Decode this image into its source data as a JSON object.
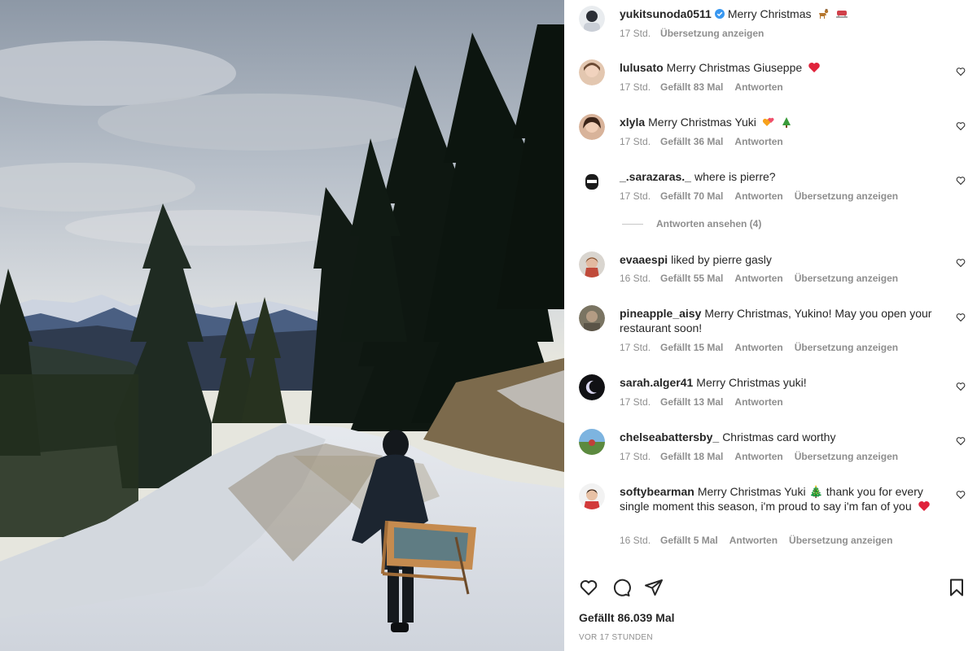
{
  "post": {
    "author": "yukitsunoda0511",
    "verified": true,
    "caption": "Merry Christmas",
    "caption_emojis": [
      "reindeer",
      "sled"
    ],
    "time": "17 Std.",
    "translate": "Übersetzung anzeigen"
  },
  "comments": [
    {
      "user": "lulusato",
      "text": "Merry Christmas Giuseppe",
      "emojis": [
        "red-heart"
      ],
      "time": "17 Std.",
      "likes": "Gefällt 83 Mal",
      "reply": "Antworten",
      "translate": ""
    },
    {
      "user": "xlyla",
      "text": "Merry Christmas Yuki",
      "emojis": [
        "two-hearts",
        "christmas-tree"
      ],
      "time": "17 Std.",
      "likes": "Gefällt 36 Mal",
      "reply": "Antworten",
      "translate": ""
    },
    {
      "user": "_.sarazaras._",
      "text": "where is pierre?",
      "emojis": [],
      "time": "17 Std.",
      "likes": "Gefällt 70 Mal",
      "reply": "Antworten",
      "translate": "Übersetzung anzeigen"
    },
    {
      "user": "evaaespi",
      "text": "liked by pierre gasly",
      "emojis": [],
      "time": "16 Std.",
      "likes": "Gefällt 55 Mal",
      "reply": "Antworten",
      "translate": "Übersetzung anzeigen"
    },
    {
      "user": "pineapple_aisy",
      "text": "Merry Christmas, Yukino! May you open your restaurant soon!",
      "emojis": [],
      "time": "17 Std.",
      "likes": "Gefällt 15 Mal",
      "reply": "Antworten",
      "translate": "Übersetzung anzeigen"
    },
    {
      "user": "sarah.alger41",
      "text": "Merry Christmas yuki!",
      "emojis": [],
      "time": "17 Std.",
      "likes": "Gefällt 13 Mal",
      "reply": "Antworten",
      "translate": ""
    },
    {
      "user": "chelseabattersby_",
      "text": "Christmas card worthy",
      "emojis": [],
      "time": "17 Std.",
      "likes": "Gefällt 18 Mal",
      "reply": "Antworten",
      "translate": "Übersetzung anzeigen"
    },
    {
      "user": "softybearman",
      "text": "Merry Christmas Yuki 🎄 thank you for every single moment this season, i'm proud to say i'm fan of you",
      "emojis": [
        "red-heart"
      ],
      "time": "16 Std.",
      "likes": "Gefällt 5 Mal",
      "reply": "Antworten",
      "translate": "Übersetzung anzeigen"
    }
  ],
  "view_replies": "Antworten ansehen (4)",
  "actions": {
    "like_icon": "heart-outline-icon",
    "comment_icon": "comment-bubble-icon",
    "share_icon": "paper-plane-icon",
    "save_icon": "bookmark-icon"
  },
  "likes_total": "Gefällt 86.039 Mal",
  "post_time": "VOR 17 STUNDEN",
  "colors": {
    "verified_blue": "#3897f0",
    "meta_gray": "#8e8e8e",
    "text": "#262626",
    "heart_red": "#ed4956"
  }
}
